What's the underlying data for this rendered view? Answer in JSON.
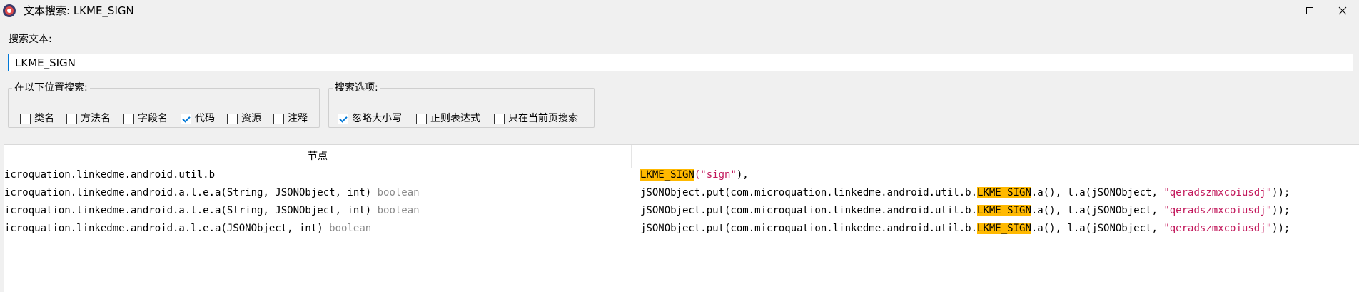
{
  "window": {
    "title": "文本搜索: LKME_SIGN",
    "buttons": [
      "minimize",
      "maximize",
      "close"
    ]
  },
  "search": {
    "label": "搜索文本:",
    "value": "LKME_SIGN"
  },
  "location_group": {
    "legend": "在以下位置搜索:",
    "options": [
      {
        "label": "类名",
        "checked": false
      },
      {
        "label": "方法名",
        "checked": false
      },
      {
        "label": "字段名",
        "checked": false
      },
      {
        "label": "代码",
        "checked": true
      },
      {
        "label": "资源",
        "checked": false
      },
      {
        "label": "注释",
        "checked": false
      }
    ]
  },
  "options_group": {
    "legend": "搜索选项:",
    "options": [
      {
        "label": "忽略大小写",
        "checked": true
      },
      {
        "label": "正则表达式",
        "checked": false
      },
      {
        "label": "只在当前页搜索",
        "checked": false
      }
    ]
  },
  "results": {
    "header_node": "节点",
    "header_code": "",
    "rows": [
      {
        "node": "icroquation.linkedme.android.util.b",
        "node_return": "",
        "code_pre": "",
        "code_match": "LKME_SIGN",
        "code_mid": "(",
        "code_string": "\"sign\"",
        "code_post": "),"
      },
      {
        "node": "icroquation.linkedme.android.a.l.e.a(String, JSONObject, int)",
        "node_return": "boolean",
        "code_pre": "jSONObject.put(com.microquation.linkedme.android.util.b.",
        "code_match": "LKME_SIGN",
        "code_mid": ".a(), l.a(jSONObject, ",
        "code_string": "\"qeradszmxcoiusdj\"",
        "code_post": "));"
      },
      {
        "node": "icroquation.linkedme.android.a.l.e.a(String, JSONObject, int)",
        "node_return": "boolean",
        "code_pre": "jSONObject.put(com.microquation.linkedme.android.util.b.",
        "code_match": "LKME_SIGN",
        "code_mid": ".a(), l.a(jSONObject, ",
        "code_string": "\"qeradszmxcoiusdj\"",
        "code_post": "));"
      },
      {
        "node": "icroquation.linkedme.android.a.l.e.a(JSONObject, int)",
        "node_return": "boolean",
        "code_pre": "jSONObject.put(com.microquation.linkedme.android.util.b.",
        "code_match": "LKME_SIGN",
        "code_mid": ".a(), l.a(jSONObject, ",
        "code_string": "\"qeradszmxcoiusdj\"",
        "code_post": "));"
      }
    ]
  },
  "colors": {
    "match_highlight": "#ffb900",
    "string_literal": "#c2185b",
    "return_type": "#8a8a8a",
    "focus_border": "#0078d7"
  }
}
